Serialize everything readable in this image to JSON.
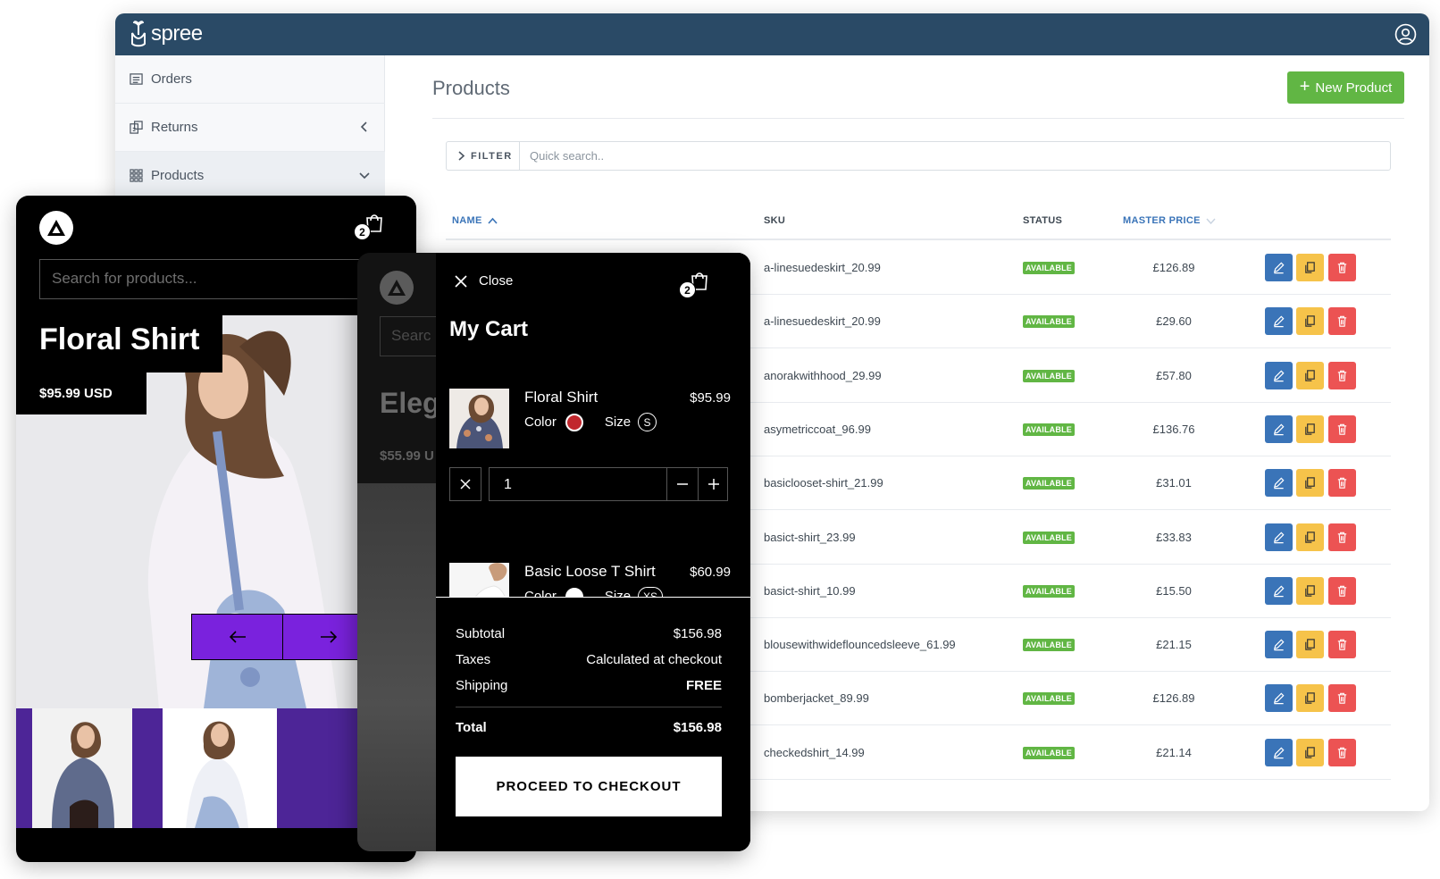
{
  "admin": {
    "brand": "spree",
    "sidebar": {
      "items": [
        {
          "label": "Orders",
          "icon": "orders-icon"
        },
        {
          "label": "Returns",
          "icon": "returns-icon"
        },
        {
          "label": "Products",
          "icon": "products-icon"
        }
      ]
    },
    "page_title": "Products",
    "new_button": "New Product",
    "filter": {
      "label": "FILTER",
      "placeholder": "Quick search.."
    },
    "table": {
      "headers": {
        "name": "NAME",
        "sku": "SKU",
        "status": "STATUS",
        "price": "MASTER PRICE"
      },
      "rows": [
        {
          "sku": "a-linesuedeskirt_20.99",
          "status": "AVAILABLE",
          "price": "£126.89"
        },
        {
          "sku": "a-linesuedeskirt_20.99",
          "status": "AVAILABLE",
          "price": "£29.60"
        },
        {
          "sku": "anorakwithhood_29.99",
          "status": "AVAILABLE",
          "price": "£57.80"
        },
        {
          "sku": "asymetriccoat_96.99",
          "status": "AVAILABLE",
          "price": "£136.76"
        },
        {
          "sku": "basiclooset-shirt_21.99",
          "status": "AVAILABLE",
          "price": "£31.01"
        },
        {
          "sku": "basict-shirt_23.99",
          "status": "AVAILABLE",
          "price": "£33.83"
        },
        {
          "sku": "basict-shirt_10.99",
          "status": "AVAILABLE",
          "price": "£15.50"
        },
        {
          "sku": "blousewithwideflouncedsleeve_61.99",
          "status": "AVAILABLE",
          "price": "£21.15"
        },
        {
          "sku": "bomberjacket_89.99",
          "status": "AVAILABLE",
          "price": "£126.89"
        },
        {
          "sku": "checkedshirt_14.99",
          "status": "AVAILABLE",
          "price": "£21.14"
        }
      ]
    },
    "colors": {
      "header": "#2a4a66",
      "primary": "#3a74b8",
      "success": "#61b644",
      "warning": "#f6c34a",
      "danger": "#ec5353"
    }
  },
  "storefront": {
    "cart_count": "2",
    "search_placeholder": "Search for products...",
    "product": {
      "name": "Floral Shirt",
      "price": "$95.99 USD"
    },
    "accent": "#7a22dd"
  },
  "background_page": {
    "search_fragment": "Searc",
    "title_fragment": "Eleg",
    "price_fragment": "$55.99 U"
  },
  "cart": {
    "close_label": "Close",
    "title": "My Cart",
    "cart_count": "2",
    "items": [
      {
        "name": "Floral Shirt",
        "price": "$95.99",
        "color_label": "Color",
        "size_label": "Size",
        "size": "S",
        "color": "#c1272d",
        "quantity": "1"
      },
      {
        "name": "Basic Loose T Shirt",
        "price": "$60.99",
        "color_label": "Color",
        "size_label": "Size",
        "size": "XS",
        "color": "#ffffff"
      }
    ],
    "summary": {
      "subtotal_label": "Subtotal",
      "subtotal": "$156.98",
      "taxes_label": "Taxes",
      "taxes": "Calculated at checkout",
      "shipping_label": "Shipping",
      "shipping": "FREE",
      "total_label": "Total",
      "total": "$156.98"
    },
    "checkout_button": "PROCEED TO CHECKOUT"
  }
}
